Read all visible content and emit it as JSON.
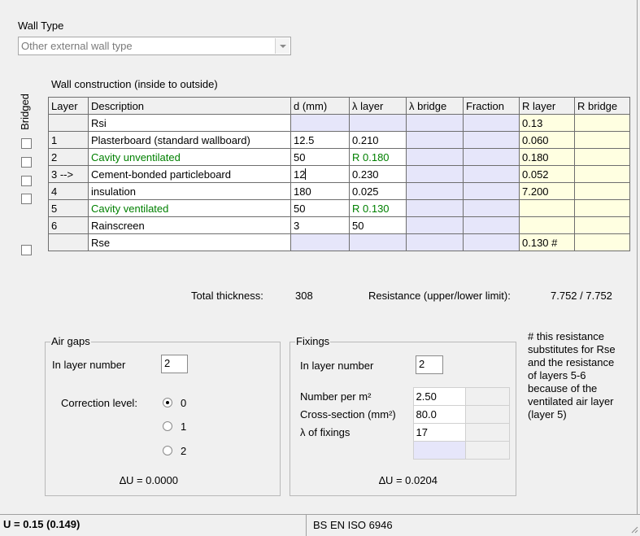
{
  "wall_type": {
    "label": "Wall Type",
    "selected": "Other external wall type"
  },
  "construction": {
    "title": "Wall construction (inside to outside)",
    "bridged_label": "Bridged",
    "columns": [
      "Layer",
      "Description",
      "d (mm)",
      "λ layer",
      "λ bridge",
      "Fraction",
      "R layer",
      "R bridge"
    ],
    "rows": [
      {
        "layer": "",
        "description": "Rsi",
        "d": "",
        "lambda": "",
        "r_layer": "0.13",
        "checkbox": false
      },
      {
        "layer": "1",
        "description": "Plasterboard (standard wallboard)",
        "d": "12.5",
        "lambda": "0.210",
        "r_layer": "0.060",
        "checkbox": true
      },
      {
        "layer": "2",
        "description": "Cavity unventilated",
        "d": "50",
        "lambda": "R 0.180",
        "r_layer": "0.180",
        "checkbox": true
      },
      {
        "layer": "3 -->",
        "description": "Cement-bonded particleboard",
        "d": "12",
        "lambda": "0.230",
        "r_layer": "0.052",
        "checkbox": true
      },
      {
        "layer": "4",
        "description": "insulation",
        "d": "180",
        "lambda": "0.025",
        "r_layer": "7.200",
        "checkbox": true
      },
      {
        "layer": "5",
        "description": "Cavity ventilated",
        "d": "50",
        "lambda": "R 0.130",
        "r_layer": "",
        "checkbox": false
      },
      {
        "layer": "6",
        "description": "Rainscreen",
        "d": "3",
        "lambda": "50",
        "r_layer": "",
        "checkbox": true
      },
      {
        "layer": "",
        "description": "Rse",
        "d": "",
        "lambda": "",
        "r_layer": "0.130 #",
        "checkbox": false
      }
    ]
  },
  "totals": {
    "thickness_label": "Total thickness:",
    "thickness_value": "308",
    "resistance_label": "Resistance (upper/lower limit):",
    "resistance_value": "7.752 / 7.752"
  },
  "air_gaps": {
    "title": "Air gaps",
    "layer_label": "In layer number",
    "layer_value": "2",
    "correction_label": "Correction level:",
    "options": [
      "0",
      "1",
      "2"
    ],
    "selected": "0",
    "delta_u": "∆U =  0.0000"
  },
  "fixings": {
    "title": "Fixings",
    "layer_label": "In layer number",
    "layer_value": "2",
    "number_label": "Number per m²",
    "number_value": "2.50",
    "cross_label": "Cross-section (mm²)",
    "cross_value": "80.0",
    "lambda_label": "λ  of fixings",
    "lambda_value": "17",
    "delta_u": "∆U =  0.0204"
  },
  "note": {
    "lines": [
      "# this resistance",
      "substitutes for Rse",
      "and the resistance",
      "of layers 5-6",
      "because of the",
      "ventilated air layer",
      "(layer 5)"
    ]
  },
  "status": {
    "u_value": "U = 0.15  (0.149)",
    "standard": "BS EN ISO 6946"
  },
  "colors": {
    "blue_cell": "#e6e6fa",
    "yellow_cell": "#ffffe1",
    "cavity_green": "#008000"
  }
}
